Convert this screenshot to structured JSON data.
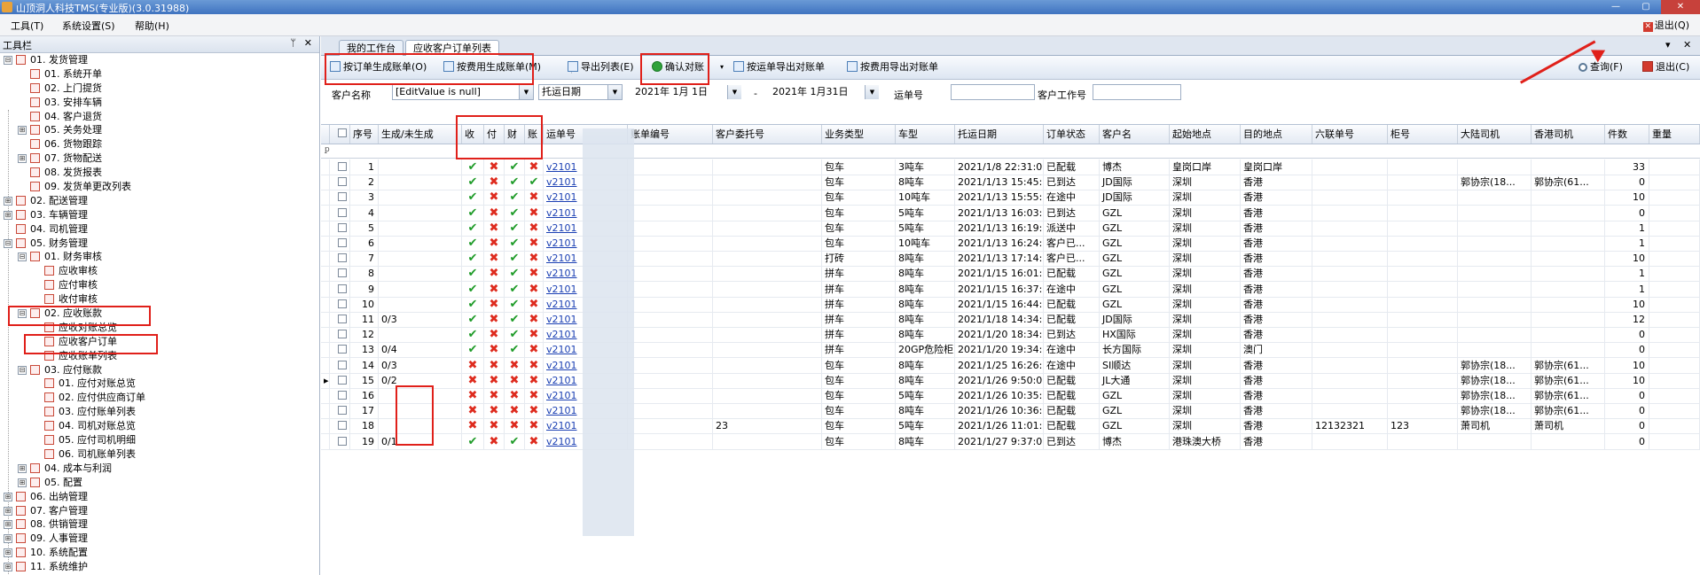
{
  "window": {
    "title": "山顶洞人科技TMS(专业版)(3.0.31988)"
  },
  "menu": {
    "items": [
      "工具(T)",
      "系统设置(S)",
      "帮助(H)"
    ],
    "exit": "退出(Q)"
  },
  "left_panel": {
    "title": "工具栏",
    "tree": [
      {
        "label": "01. 发货管理",
        "level": 0,
        "exp": "⊟"
      },
      {
        "label": "01. 系统开单",
        "level": 1
      },
      {
        "label": "02. 上门提货",
        "level": 1
      },
      {
        "label": "03. 安排车辆",
        "level": 1
      },
      {
        "label": "04. 客户退货",
        "level": 1
      },
      {
        "label": "05. 关务处理",
        "level": 1,
        "exp": "⊞"
      },
      {
        "label": "06. 货物跟踪",
        "level": 1
      },
      {
        "label": "07. 货物配送",
        "level": 1,
        "exp": "⊞"
      },
      {
        "label": "08. 发货报表",
        "level": 1
      },
      {
        "label": "09. 发货单更改列表",
        "level": 1
      },
      {
        "label": "02. 配送管理",
        "level": 0,
        "exp": "⊞"
      },
      {
        "label": "03. 车辆管理",
        "level": 0,
        "exp": "⊞"
      },
      {
        "label": "04. 司机管理",
        "level": 0
      },
      {
        "label": "05. 财务管理",
        "level": 0,
        "exp": "⊟"
      },
      {
        "label": "01. 财务审核",
        "level": 1,
        "exp": "⊟"
      },
      {
        "label": "应收审核",
        "level": 2
      },
      {
        "label": "应付审核",
        "level": 2
      },
      {
        "label": "收付审核",
        "level": 2
      },
      {
        "label": "02. 应收账款",
        "level": 1,
        "exp": "⊟"
      },
      {
        "label": "应收对账总览",
        "level": 2
      },
      {
        "label": "应收客户订单",
        "level": 2
      },
      {
        "label": "应收账单列表",
        "level": 2
      },
      {
        "label": "03. 应付账款",
        "level": 1,
        "exp": "⊟"
      },
      {
        "label": "01. 应付对账总览",
        "level": 2
      },
      {
        "label": "02. 应付供应商订单",
        "level": 2
      },
      {
        "label": "03. 应付账单列表",
        "level": 2
      },
      {
        "label": "04. 司机对账总览",
        "level": 2
      },
      {
        "label": "05. 应付司机明细",
        "level": 2
      },
      {
        "label": "06. 司机账单列表",
        "level": 2
      },
      {
        "label": "04. 成本与利润",
        "level": 1,
        "exp": "⊞"
      },
      {
        "label": "05. 配置",
        "level": 1,
        "exp": "⊞"
      },
      {
        "label": "06. 出纳管理",
        "level": 0,
        "exp": "⊞"
      },
      {
        "label": "07. 客户管理",
        "level": 0,
        "exp": "⊞"
      },
      {
        "label": "08. 供销管理",
        "level": 0,
        "exp": "⊞"
      },
      {
        "label": "09. 人事管理",
        "level": 0,
        "exp": "⊞"
      },
      {
        "label": "10. 系统配置",
        "level": 0,
        "exp": "⊞"
      },
      {
        "label": "11. 系统维护",
        "level": 0,
        "exp": "⊞"
      }
    ]
  },
  "tabs": [
    {
      "label": "我的工作台"
    },
    {
      "label": "应收客户订单列表"
    }
  ],
  "toolbar": {
    "by_order": "按订单生成账单(O)",
    "by_fee": "按费用生成账单(M)",
    "export": "导出列表(E)",
    "confirm": "确认对账",
    "export_waybill": "按运单导出对账单",
    "export_fee": "按费用导出对账单",
    "query": "查询(F)",
    "exit": "退出(C)"
  },
  "filters": {
    "customer_label": "客户名称",
    "customer_value": "[EditValue is null]",
    "date_type": "托运日期",
    "date_from": "2021年 1月 1日",
    "date_sep": "-",
    "date_to": "2021年 1月31日",
    "waybill_label": "运单号",
    "customer_no_label": "客户工作号"
  },
  "grid": {
    "headers": [
      "序号",
      "生成/未生成",
      "收",
      "付",
      "财",
      "账",
      "运单号",
      "账单编号",
      "客户委托号",
      "业务类型",
      "车型",
      "托运日期",
      "订单状态",
      "客户名",
      "起始地点",
      "目的地点",
      "六联单号",
      "柜号",
      "大陆司机",
      "香港司机",
      "件数",
      "重量"
    ],
    "rows": [
      {
        "seq": "1",
        "gen": "",
        "flags": [
          1,
          0,
          1,
          0
        ],
        "waybill": "v2101",
        "entrust": "",
        "biz": "包车",
        "car": "3吨车",
        "date": "2021/1/8 22:31:00",
        "status": "已配载",
        "cust": "博杰",
        "from": "皇岗口岸",
        "to": "皇岗口岸",
        "six": "",
        "cab": "",
        "mld": "",
        "hkd": "",
        "qty": "33"
      },
      {
        "seq": "2",
        "gen": "",
        "flags": [
          1,
          0,
          1,
          1
        ],
        "waybill": "v2101",
        "entrust": "",
        "biz": "包车",
        "car": "8吨车",
        "date": "2021/1/13 15:45:...",
        "status": "已到达",
        "cust": "JD国际",
        "from": "深圳",
        "to": "香港",
        "six": "",
        "cab": "",
        "mld": "郭协宗(18...",
        "hkd": "郭协宗(61...",
        "qty": "0"
      },
      {
        "seq": "3",
        "gen": "",
        "flags": [
          1,
          0,
          1,
          0
        ],
        "waybill": "v2101",
        "entrust": "",
        "biz": "包车",
        "car": "10吨车",
        "date": "2021/1/13 15:55:...",
        "status": "在途中",
        "cust": "JD国际",
        "from": "深圳",
        "to": "香港",
        "six": "",
        "cab": "",
        "mld": "",
        "hkd": "",
        "qty": "10"
      },
      {
        "seq": "4",
        "gen": "",
        "flags": [
          1,
          0,
          1,
          0
        ],
        "waybill": "v2101",
        "entrust": "",
        "biz": "包车",
        "car": "5吨车",
        "date": "2021/1/13 16:03:...",
        "status": "已到达",
        "cust": "GZL",
        "from": "深圳",
        "to": "香港",
        "six": "",
        "cab": "",
        "mld": "",
        "hkd": "",
        "qty": "0"
      },
      {
        "seq": "5",
        "gen": "",
        "flags": [
          1,
          0,
          1,
          0
        ],
        "waybill": "v2101",
        "entrust": "",
        "biz": "包车",
        "car": "5吨车",
        "date": "2021/1/13 16:19:...",
        "status": "派送中",
        "cust": "GZL",
        "from": "深圳",
        "to": "香港",
        "six": "",
        "cab": "",
        "mld": "",
        "hkd": "",
        "qty": "1"
      },
      {
        "seq": "6",
        "gen": "",
        "flags": [
          1,
          0,
          1,
          0
        ],
        "waybill": "v2101",
        "entrust": "",
        "biz": "包车",
        "car": "10吨车",
        "date": "2021/1/13 16:24:...",
        "status": "客户已...",
        "cust": "GZL",
        "from": "深圳",
        "to": "香港",
        "six": "",
        "cab": "",
        "mld": "",
        "hkd": "",
        "qty": "1"
      },
      {
        "seq": "7",
        "gen": "",
        "flags": [
          1,
          0,
          1,
          0
        ],
        "waybill": "v2101",
        "entrust": "",
        "biz": "打砖",
        "car": "8吨车",
        "date": "2021/1/13 17:14:...",
        "status": "客户已...",
        "cust": "GZL",
        "from": "深圳",
        "to": "香港",
        "six": "",
        "cab": "",
        "mld": "",
        "hkd": "",
        "qty": "10"
      },
      {
        "seq": "8",
        "gen": "",
        "flags": [
          1,
          0,
          1,
          0
        ],
        "waybill": "v2101",
        "entrust": "",
        "biz": "拼车",
        "car": "8吨车",
        "date": "2021/1/15 16:01:...",
        "status": "已配载",
        "cust": "GZL",
        "from": "深圳",
        "to": "香港",
        "six": "",
        "cab": "",
        "mld": "",
        "hkd": "",
        "qty": "1"
      },
      {
        "seq": "9",
        "gen": "",
        "flags": [
          1,
          0,
          1,
          0
        ],
        "waybill": "v2101",
        "entrust": "",
        "biz": "拼车",
        "car": "8吨车",
        "date": "2021/1/15 16:37:...",
        "status": "在途中",
        "cust": "GZL",
        "from": "深圳",
        "to": "香港",
        "six": "",
        "cab": "",
        "mld": "",
        "hkd": "",
        "qty": "1"
      },
      {
        "seq": "10",
        "gen": "",
        "flags": [
          1,
          0,
          1,
          0
        ],
        "waybill": "v2101",
        "entrust": "",
        "biz": "拼车",
        "car": "8吨车",
        "date": "2021/1/15 16:44:...",
        "status": "已配载",
        "cust": "GZL",
        "from": "深圳",
        "to": "香港",
        "six": "",
        "cab": "",
        "mld": "",
        "hkd": "",
        "qty": "10"
      },
      {
        "seq": "11",
        "gen": "0/3",
        "flags": [
          1,
          0,
          1,
          0
        ],
        "waybill": "v2101",
        "entrust": "",
        "biz": "拼车",
        "car": "8吨车",
        "date": "2021/1/18 14:34:...",
        "status": "已配载",
        "cust": "JD国际",
        "from": "深圳",
        "to": "香港",
        "six": "",
        "cab": "",
        "mld": "",
        "hkd": "",
        "qty": "12"
      },
      {
        "seq": "12",
        "gen": "",
        "flags": [
          1,
          0,
          1,
          0
        ],
        "waybill": "v2101",
        "entrust": "",
        "biz": "拼车",
        "car": "8吨车",
        "date": "2021/1/20 18:34:...",
        "status": "已到达",
        "cust": "HX国际",
        "from": "深圳",
        "to": "香港",
        "six": "",
        "cab": "",
        "mld": "",
        "hkd": "",
        "qty": "0"
      },
      {
        "seq": "13",
        "gen": "0/4",
        "flags": [
          1,
          0,
          1,
          0
        ],
        "waybill": "v2101",
        "entrust": "",
        "biz": "拼车",
        "car": "20GP危险柜",
        "date": "2021/1/20 19:34:...",
        "status": "在途中",
        "cust": "长方国际",
        "from": "深圳",
        "to": "澳门",
        "six": "",
        "cab": "",
        "mld": "",
        "hkd": "",
        "qty": "0"
      },
      {
        "seq": "14",
        "gen": "0/3",
        "flags": [
          0,
          0,
          0,
          0
        ],
        "waybill": "v2101",
        "entrust": "",
        "biz": "包车",
        "car": "8吨车",
        "date": "2021/1/25 16:26:...",
        "status": "在途中",
        "cust": "SI顺达",
        "from": "深圳",
        "to": "香港",
        "six": "",
        "cab": "",
        "mld": "郭协宗(18...",
        "hkd": "郭协宗(61...",
        "qty": "10"
      },
      {
        "seq": "15",
        "gen": "0/2",
        "flags": [
          0,
          0,
          0,
          0
        ],
        "waybill": "v2101",
        "entrust": "",
        "biz": "包车",
        "car": "8吨车",
        "date": "2021/1/26 9:50:00",
        "status": "已配载",
        "cust": "JL大通",
        "from": "深圳",
        "to": "香港",
        "six": "",
        "cab": "",
        "mld": "郭协宗(18...",
        "hkd": "郭协宗(61...",
        "qty": "10"
      },
      {
        "seq": "16",
        "gen": "",
        "flags": [
          0,
          0,
          0,
          0
        ],
        "waybill": "v2101",
        "entrust": "",
        "biz": "包车",
        "car": "5吨车",
        "date": "2021/1/26 10:35:...",
        "status": "已配载",
        "cust": "GZL",
        "from": "深圳",
        "to": "香港",
        "six": "",
        "cab": "",
        "mld": "郭协宗(18...",
        "hkd": "郭协宗(61...",
        "qty": "0"
      },
      {
        "seq": "17",
        "gen": "",
        "flags": [
          0,
          0,
          0,
          0
        ],
        "waybill": "v2101",
        "entrust": "",
        "biz": "包车",
        "car": "8吨车",
        "date": "2021/1/26 10:36:...",
        "status": "已配载",
        "cust": "GZL",
        "from": "深圳",
        "to": "香港",
        "six": "",
        "cab": "",
        "mld": "郭协宗(18...",
        "hkd": "郭协宗(61...",
        "qty": "0"
      },
      {
        "seq": "18",
        "gen": "",
        "flags": [
          0,
          0,
          0,
          0
        ],
        "waybill": "v2101",
        "entrust": "23",
        "biz": "包车",
        "car": "5吨车",
        "date": "2021/1/26 11:01:...",
        "status": "已配载",
        "cust": "GZL",
        "from": "深圳",
        "to": "香港",
        "six": "12132321",
        "cab": "123",
        "mld": "萧司机",
        "hkd": "萧司机",
        "qty": "0"
      },
      {
        "seq": "19",
        "gen": "0/1",
        "flags": [
          1,
          0,
          1,
          0
        ],
        "waybill": "v2101",
        "entrust": "",
        "biz": "包车",
        "car": "8吨车",
        "date": "2021/1/27 9:37:00",
        "status": "已到达",
        "cust": "博杰",
        "from": "港珠澳大桥",
        "to": "香港",
        "six": "",
        "cab": "",
        "mld": "",
        "hkd": "",
        "qty": "0"
      }
    ]
  },
  "colors": {
    "accent": "#3f73c0",
    "highlight": "#e0201a",
    "ok": "#1e9b28",
    "no": "#de2b1e"
  }
}
